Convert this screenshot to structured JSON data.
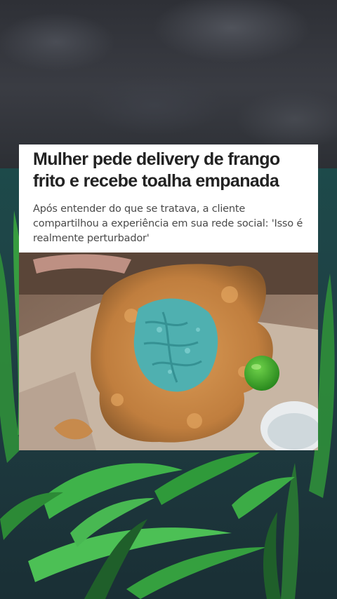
{
  "article": {
    "headline": "Mulher pede delivery de frango frito e recebe toalha empanada",
    "subhead": "Após entender do que se tratava, a cliente compartilhou a experiência em sua rede social: 'Isso é realmente perturbador'"
  },
  "colors": {
    "card_background": "#ffffff",
    "headline_text": "#222222",
    "subhead_text": "#4a4a4a",
    "fried_coating": "#c98a45",
    "towel": "#4fb0b0",
    "lime": "#3aa428",
    "water": "#1d4a4a",
    "plants": "#2f8f3a"
  },
  "icons": {
    "background": "stormy-sky-and-seaweed-illustration",
    "photo": "fried-chicken-towel-photo"
  }
}
